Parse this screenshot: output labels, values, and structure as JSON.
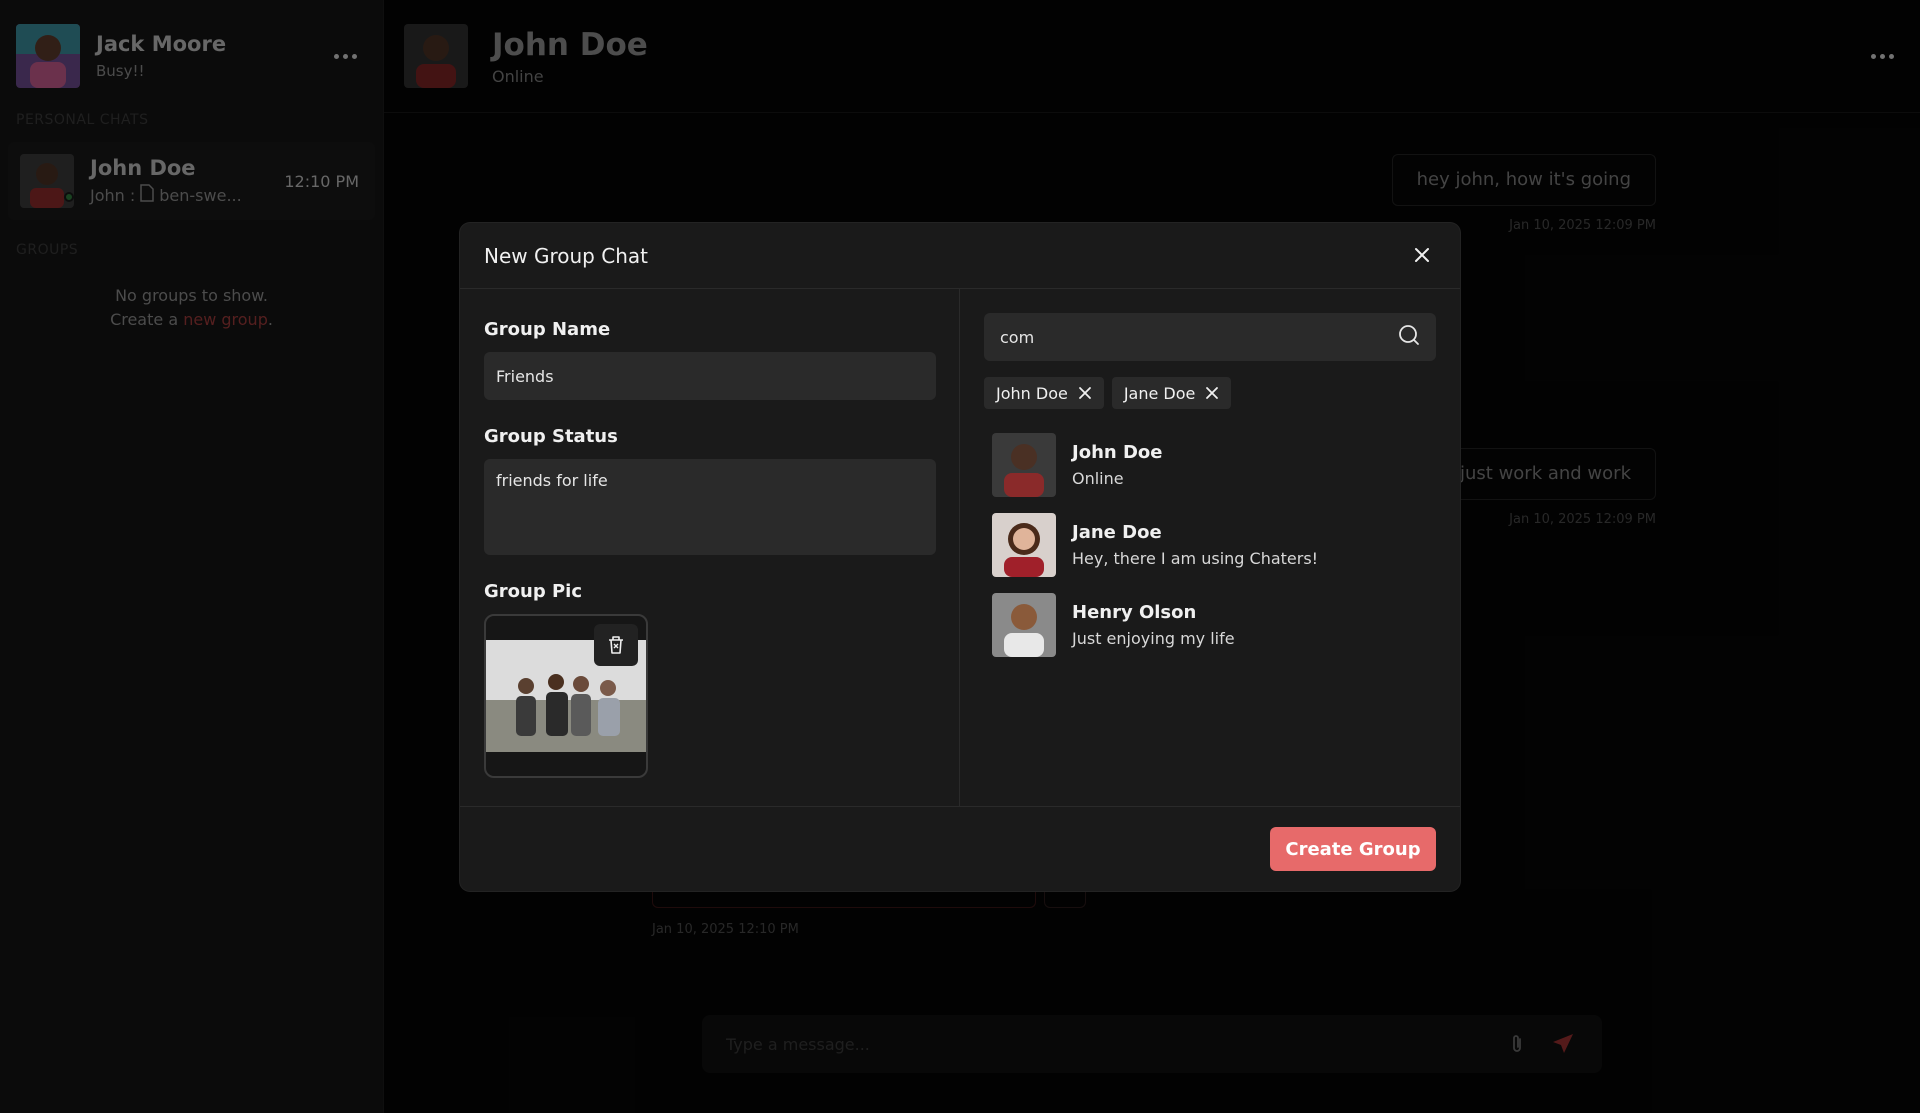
{
  "me": {
    "name": "Jack Moore",
    "status": "Busy!!"
  },
  "sidebar": {
    "personal_label": "PERSONAL CHATS",
    "groups_label": "GROUPS",
    "chat": {
      "name": "John Doe",
      "last_sender": "John :",
      "last_file": "ben-swe...",
      "time": "12:10 PM"
    },
    "empty_groups_line1": "No groups to show.",
    "empty_groups_pre": "Create a",
    "empty_groups_link": "new group",
    "empty_groups_post": "."
  },
  "chat_header": {
    "name": "John Doe",
    "status": "Online"
  },
  "messages": [
    {
      "text": "hey john, how it's going",
      "time": "Jan 10, 2025 12:09 PM"
    },
    {
      "text": "just work and work",
      "time": "Jan 10, 2025 12:09 PM"
    }
  ],
  "left_message_time": "Jan 10, 2025 12:10 PM",
  "composer": {
    "placeholder": "Type a message..."
  },
  "modal": {
    "title": "New Group Chat",
    "group_name_label": "Group Name",
    "group_name_value": "Friends",
    "group_status_label": "Group Status",
    "group_status_value": "friends for life",
    "group_pic_label": "Group Pic",
    "search_value": "com",
    "chips": [
      "John Doe",
      "Jane Doe"
    ],
    "users": [
      {
        "name": "John Doe",
        "status": "Online"
      },
      {
        "name": "Jane Doe",
        "status": "Hey, there I am using Chaters!"
      },
      {
        "name": "Henry Olson",
        "status": "Just enjoying my life"
      }
    ],
    "create_label": "Create Group"
  },
  "colors": {
    "accent": "#e76a6a",
    "link": "#9c3a3a",
    "online": "#2f7a3c"
  },
  "icons": [
    "three-dots-icon",
    "file-icon",
    "close-icon",
    "search-icon",
    "trash-icon",
    "attachment-icon",
    "send-icon"
  ]
}
